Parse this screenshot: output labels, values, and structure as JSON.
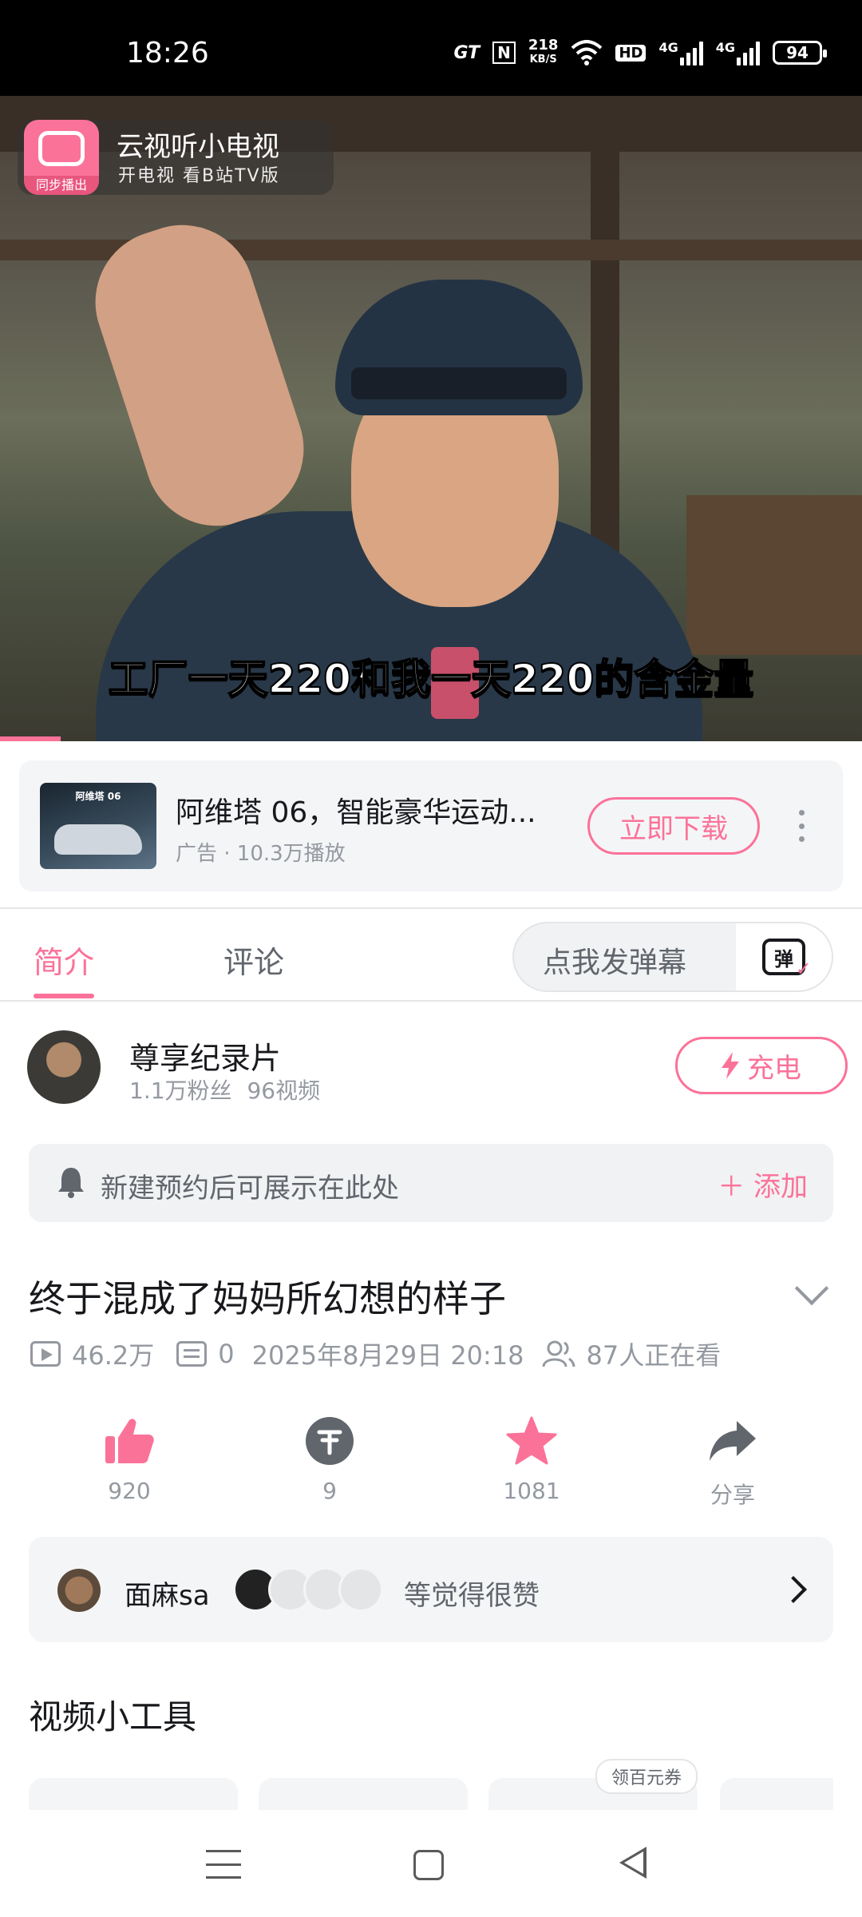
{
  "status_bar": {
    "time": "18:26",
    "gt": "GT",
    "nfc": "N",
    "speed": "218",
    "speed_unit": "KB/S",
    "hd": "HD",
    "net1": "4G",
    "net2": "4G",
    "battery": "94"
  },
  "video": {
    "subtitle": "工厂一天220和我一天220的含金量",
    "overlay": {
      "brand": "云视听小电视",
      "tagline": "开电视 看B站TV版",
      "badge": "同步播出"
    },
    "progress_fraction": 0.07
  },
  "ad": {
    "title": "阿维塔 06，智能豪华运动...",
    "meta": "广告 · 10.3万播放",
    "cta": "立即下载",
    "thumb_caption": "阿维塔 06"
  },
  "tabs": {
    "intro": "简介",
    "comments": "评论",
    "danmu_placeholder": "点我发弹幕",
    "danmu_icon_text": "弹"
  },
  "uploader": {
    "name": "尊享纪录片",
    "fans": "1.1万粉丝",
    "videos": "96视频",
    "charge": "充电"
  },
  "reserve": {
    "text": "新建预约后可展示在此处",
    "add": "添加"
  },
  "video_info": {
    "title": "终于混成了妈妈所幻想的样子",
    "plays": "46.2万",
    "danmaku": "0",
    "date": "2025年8月29日 20:18",
    "watching": "87人正在看"
  },
  "actions": {
    "like": "920",
    "coin": "9",
    "fav": "1081",
    "share": "分享"
  },
  "liked_by": {
    "user": "面麻sa",
    "suffix": "等觉得很赞"
  },
  "tools": {
    "title": "视频小工具",
    "coupon": "领百元券"
  },
  "colors": {
    "accent": "#fb7299",
    "text": "#18191c",
    "muted": "#9499a0"
  },
  "icons": [
    "bell-icon",
    "play-count-icon",
    "danmaku-icon",
    "watching-icon",
    "like-icon",
    "coin-icon",
    "star-icon",
    "share-icon",
    "lightning-icon",
    "chevron-down-icon",
    "chevron-right-icon",
    "more-icon"
  ]
}
